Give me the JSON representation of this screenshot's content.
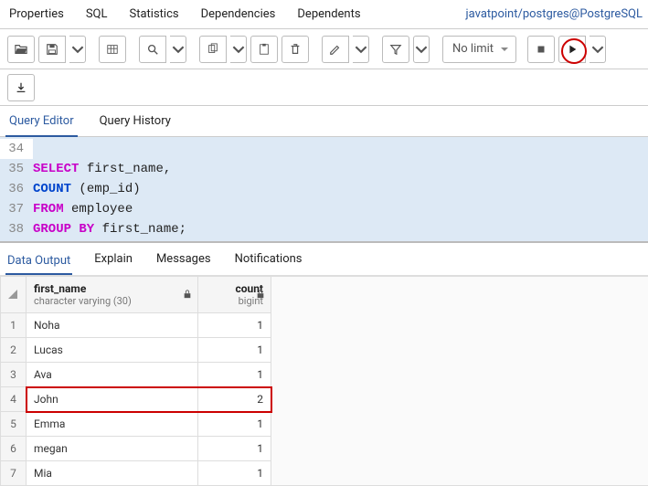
{
  "top_tabs": {
    "properties": "Properties",
    "sql": "SQL",
    "statistics": "Statistics",
    "dependencies": "Dependencies",
    "dependents": "Dependents",
    "connection": "javatpoint/postgres@PostgreSQL"
  },
  "toolbar": {
    "limit_label": "No limit"
  },
  "editor_tabs": {
    "query_editor": "Query Editor",
    "query_history": "Query History"
  },
  "code": {
    "lines": [
      {
        "n": 34,
        "t": ""
      },
      {
        "n": 35,
        "t": "SELECT first_name,"
      },
      {
        "n": 36,
        "t": "COUNT (emp_id)"
      },
      {
        "n": 37,
        "t": "FROM employee"
      },
      {
        "n": 38,
        "t": "GROUP BY first_name;"
      }
    ]
  },
  "result_tabs": {
    "data_output": "Data Output",
    "explain": "Explain",
    "messages": "Messages",
    "notifications": "Notifications"
  },
  "grid": {
    "columns": [
      {
        "name": "first_name",
        "type": "character varying (30)"
      },
      {
        "name": "count",
        "type": "bigint"
      }
    ],
    "rows": [
      {
        "n": 1,
        "first_name": "Noha",
        "count": 1
      },
      {
        "n": 2,
        "first_name": "Lucas",
        "count": 1
      },
      {
        "n": 3,
        "first_name": "Ava",
        "count": 1
      },
      {
        "n": 4,
        "first_name": "John",
        "count": 2
      },
      {
        "n": 5,
        "first_name": "Emma",
        "count": 1
      },
      {
        "n": 6,
        "first_name": "megan",
        "count": 1
      },
      {
        "n": 7,
        "first_name": "Mia",
        "count": 1
      }
    ],
    "highlight_index": 3
  },
  "chart_data": {
    "type": "table",
    "title": "Data Output",
    "columns": [
      "first_name",
      "count"
    ],
    "rows": [
      [
        "Noha",
        1
      ],
      [
        "Lucas",
        1
      ],
      [
        "Ava",
        1
      ],
      [
        "John",
        2
      ],
      [
        "Emma",
        1
      ],
      [
        "megan",
        1
      ],
      [
        "Mia",
        1
      ]
    ]
  }
}
